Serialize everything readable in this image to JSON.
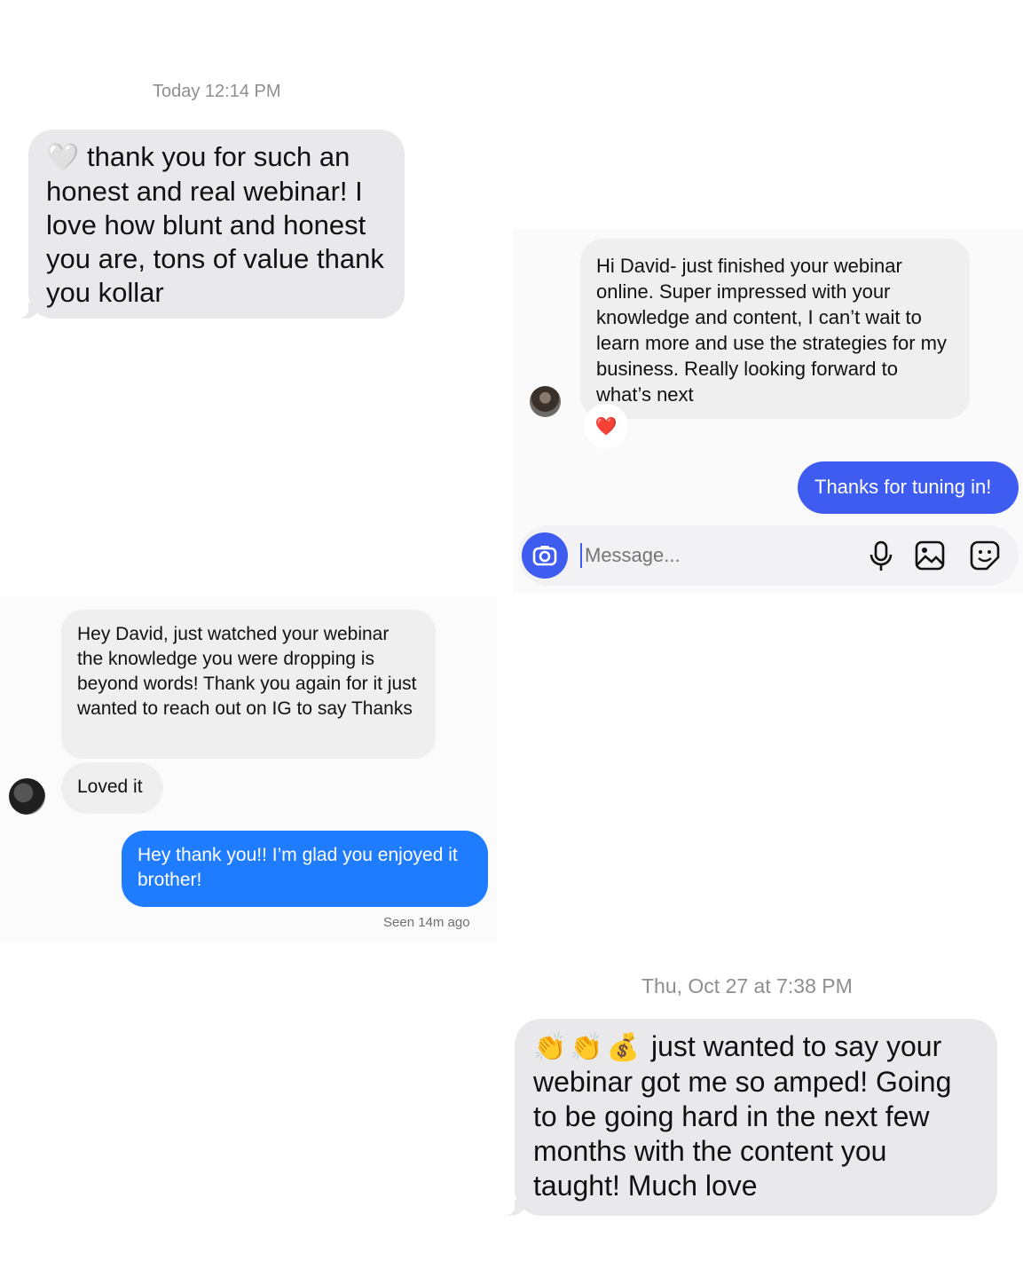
{
  "panel1": {
    "timestamp": "Today 12:14 PM",
    "message": "thank you for such an honest and real webinar! I love how blunt and honest you are, tons of value thank you kollar",
    "leading_emoji": "🤍"
  },
  "panel2": {
    "incoming": "Hi David-  just finished your webinar online. Super impressed with your knowledge and content, I can’t wait to learn more and use the strategies for my business. Really looking forward to what’s next",
    "reaction": "❤️",
    "outgoing": "Thanks for tuning in!",
    "composer_placeholder": "Message...",
    "icons": [
      "camera-icon",
      "microphone-icon",
      "gallery-icon",
      "sticker-icon"
    ],
    "accent_color": "#3e5cf0"
  },
  "panel3": {
    "incoming_1": "Hey David, just watched your webinar the knowledge you were dropping is beyond words! Thank you again for it just wanted to reach out on IG to say Thanks",
    "incoming_2": "Loved it",
    "outgoing": "Hey thank you!! I’m glad you enjoyed it brother!",
    "seen": "Seen 14m ago",
    "accent_color": "#1f7cff"
  },
  "panel4": {
    "timestamp": "Thu, Oct 27 at 7:38 PM",
    "leading_emojis": "👏👏💰",
    "message": "just wanted to say your webinar got me so amped! Going to be going hard in the next few months with the content you taught! Much love"
  }
}
